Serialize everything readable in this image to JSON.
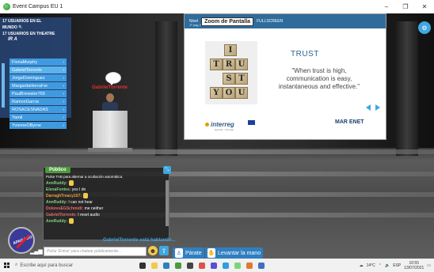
{
  "window": {
    "title": "Event Campus EU 1",
    "minimize": "–",
    "restore": "❐",
    "close": "✕"
  },
  "users_panel": {
    "header_lines": [
      "17 USUARIOS EN EL",
      "MUNDO 🔍",
      "17 USUARIOS EN THEATRE"
    ],
    "ira": "IR A",
    "items": [
      {
        "label": "FionaMurphy"
      },
      {
        "label": "GabrielTorrente"
      },
      {
        "label": "JorgeDominguez"
      },
      {
        "label": "MargaritaHerraFer"
      },
      {
        "label": "PaulBrewster765"
      },
      {
        "label": "RamonGarcia"
      },
      {
        "label": "ROSACESNADAS"
      },
      {
        "label": "Yamil"
      },
      {
        "label": "YvonneOByrne"
      }
    ]
  },
  "slide": {
    "zoom_label": "Zoom de Pantalla",
    "small_label_left": "Nivel",
    "small_label_right": "FULLSCREEN",
    "page_label": "1º pag 2",
    "tiles": [
      "T",
      "R",
      "U",
      "S",
      "T",
      "Y",
      "O",
      "U",
      "I"
    ],
    "trust_title": "TRUST",
    "quote": "\"When trust is high, communication is easy, instantaneous and effective.\"",
    "logo_left": "interreg",
    "logo_left_sub": "España - Portugal",
    "logo_right": "MAR ENET"
  },
  "presenter": {
    "nametag": "GabrielTorrente"
  },
  "chat": {
    "title": "Público",
    "hint": "Pulse TAB para alternar a ocultación automática.",
    "messages": [
      {
        "who": "AnnRuddy:",
        "text": "",
        "thumb": true,
        "color": "#7fd37f"
      },
      {
        "who": "ElenaFontes:",
        "text": " yes I do",
        "thumb": false,
        "color": "#7fd37f"
      },
      {
        "who": "DarraghTreacy107:",
        "text": "",
        "thumb": true,
        "color": "#f29a3c"
      },
      {
        "who": "AnnRuddy:",
        "text": " I can not hear",
        "thumb": false,
        "color": "#7fd37f"
      },
      {
        "who": "DoloresEGSchmidt:",
        "text": " me neither",
        "thumb": false,
        "color": "#e86a6a"
      },
      {
        "who": "GabrielTorrente:",
        "text": " I reset audio",
        "thumb": false,
        "color": "#e86a6a"
      },
      {
        "who": "AnnRuddy:",
        "text": "",
        "thumb": true,
        "color": "#7fd37f"
      }
    ],
    "speaking": "GabrielTorrente está hablando...",
    "input_placeholder": "Pulse 'Entrar' para chatear públicamente...",
    "emoji": "☻",
    "send": "⇧"
  },
  "mic": {
    "label": "APAGADO"
  },
  "actions": {
    "stand": "Párate",
    "raise_hand": "Levantar la mano"
  },
  "taskbar": {
    "search_placeholder": "Escribe aquí para buscar",
    "tray_temp": "14°C",
    "time": "10:55",
    "date": "13/07/2021",
    "lang": "ESP"
  }
}
